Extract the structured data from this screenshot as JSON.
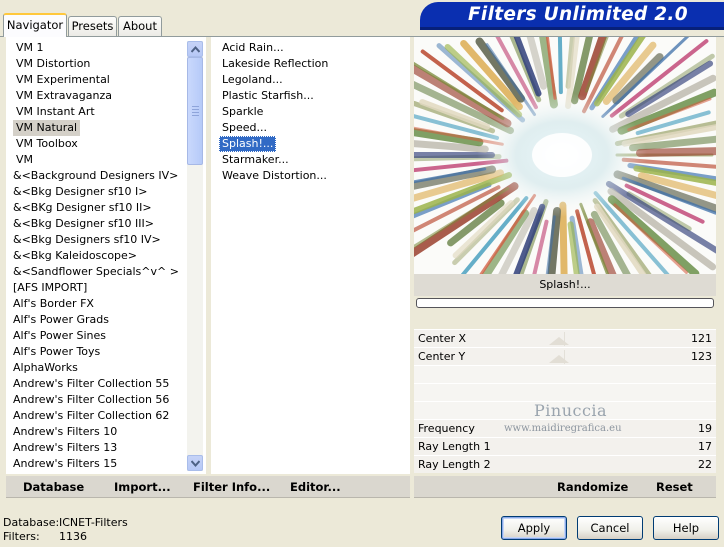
{
  "banner": {
    "title": "Filters Unlimited 2.0"
  },
  "tabs": [
    {
      "label": "Navigator",
      "active": true
    },
    {
      "label": "Presets",
      "active": false
    },
    {
      "label": "About",
      "active": false
    }
  ],
  "categories": {
    "items": [
      "VM 1",
      "VM Distortion",
      "VM Experimental",
      "VM Extravaganza",
      "VM Instant Art",
      "VM Natural",
      "VM Toolbox",
      "VM",
      "&<Background Designers IV>",
      "&<Bkg Designer sf10 I>",
      "&<BKg Designer sf10 II>",
      "&<Bkg Designer sf10 III>",
      "&<Bkg Designers sf10 IV>",
      "&<Bkg Kaleidoscope>",
      "&<Sandflower Specials^v^ >",
      "[AFS IMPORT]",
      "Alf's Border FX",
      "Alf's Power Grads",
      "Alf's Power Sines",
      "Alf's Power Toys",
      "AlphaWorks",
      "Andrew's Filter Collection 55",
      "Andrew's Filter Collection 56",
      "Andrew's Filter Collection 62",
      "Andrew's Filters 10",
      "Andrew's Filters 13",
      "Andrew's Filters 15"
    ],
    "selected": "VM Natural"
  },
  "filters": {
    "items": [
      "Acid Rain...",
      "Lakeside Reflection",
      "Legoland...",
      "Plastic Starfish...",
      "Sparkle",
      "Speed...",
      "Splash!...",
      "Starmaker...",
      "Weave Distortion..."
    ],
    "selected": "Splash!..."
  },
  "preview": {
    "filter_name": "Splash!...",
    "progress": 0
  },
  "params": {
    "center_x": {
      "label": "Center X",
      "value": "121"
    },
    "center_y": {
      "label": "Center Y",
      "value": "123"
    },
    "frequency": {
      "label": "Frequency",
      "value": "19"
    },
    "ray_length_1": {
      "label": "Ray Length 1",
      "value": "17"
    },
    "ray_length_2": {
      "label": "Ray Length 2",
      "value": "22"
    }
  },
  "watermark": {
    "name": "Pinuccia",
    "url": "www.maidiregrafica.eu"
  },
  "toolbar": {
    "database": "Database",
    "import": "Import...",
    "filter_info": "Filter Info...",
    "editor": "Editor...",
    "randomize": "Randomize",
    "reset": "Reset"
  },
  "status": {
    "database_label": "Database:",
    "database_value": "ICNET-Filters",
    "filters_label": "Filters:",
    "filters_value": "1136"
  },
  "buttons": {
    "apply": "Apply",
    "cancel": "Cancel",
    "help": "Help"
  }
}
